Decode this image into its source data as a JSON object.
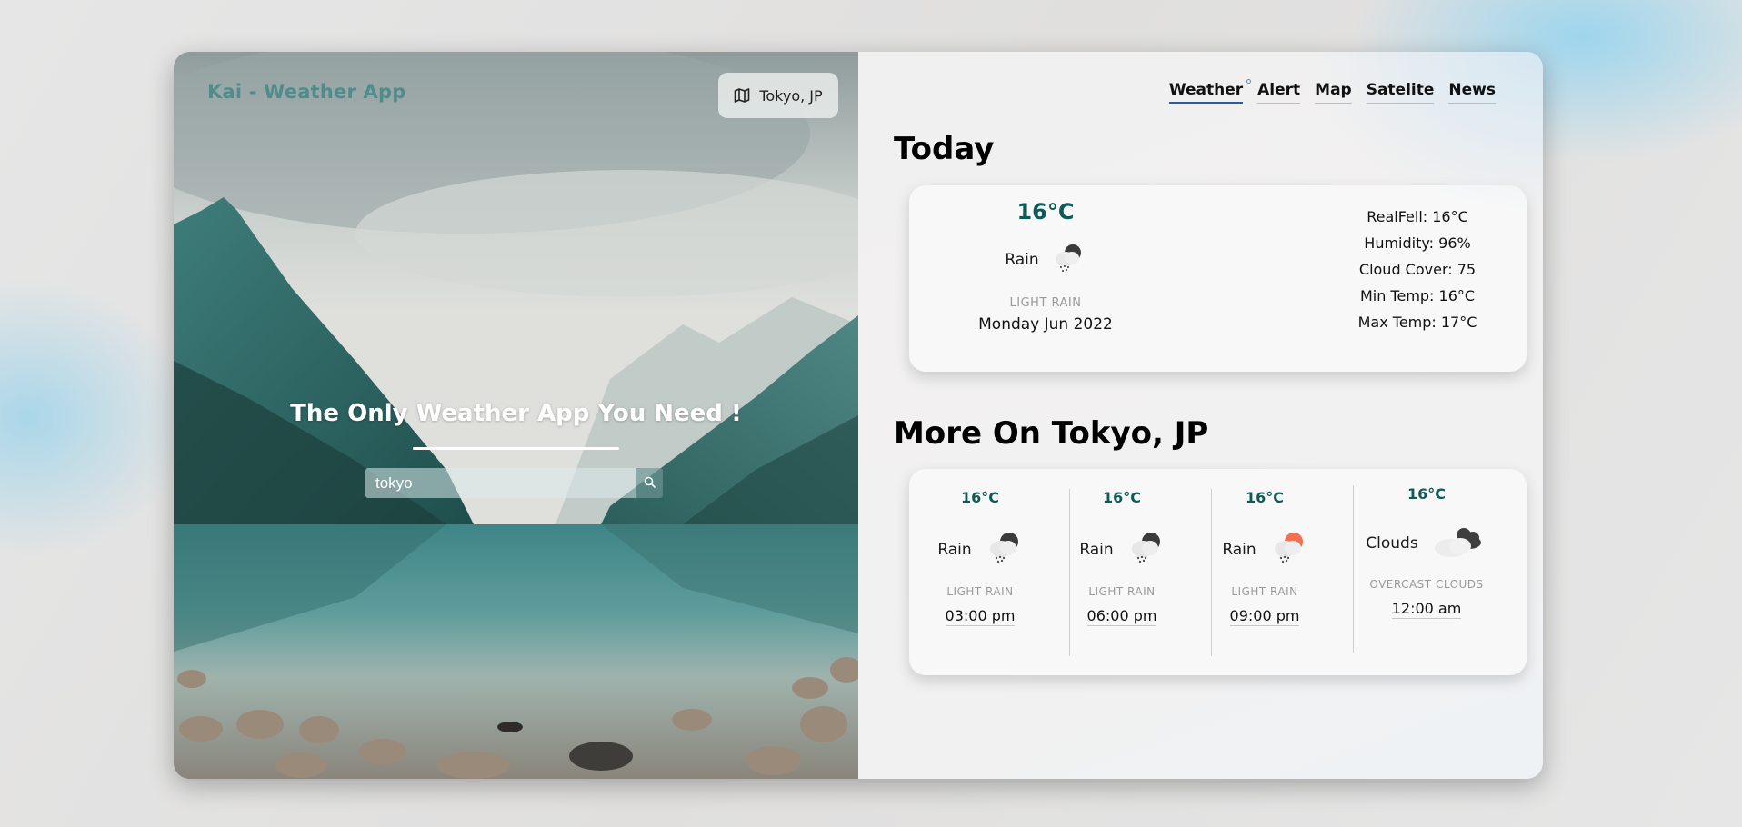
{
  "app": {
    "brand": "Kai - Weather App",
    "location_button": "Tokyo, JP"
  },
  "hero": {
    "title": "The Only Weather App You Need !",
    "search_value": "tokyo"
  },
  "nav": {
    "items": [
      {
        "label": "Weather",
        "active": true
      },
      {
        "label": "Alert",
        "active": false
      },
      {
        "label": "Map",
        "active": false
      },
      {
        "label": "Satelite",
        "active": false
      },
      {
        "label": "News",
        "active": false
      }
    ]
  },
  "today": {
    "heading": "Today",
    "temp": "16°C",
    "condition": "Rain",
    "condition_icon": "rain-cloud-icon",
    "description": "LIGHT RAIN",
    "date": "Monday Jun 2022",
    "details": [
      "RealFell: 16°C",
      "Humidity: 96%",
      "Cloud Cover: 75",
      "Min Temp: 16°C",
      "Max Temp: 17°C"
    ]
  },
  "more": {
    "heading": "More On Tokyo, JP",
    "forecast": [
      {
        "temp": "16°C",
        "condition": "Rain",
        "icon": "rain-cloud-icon",
        "description": "LIGHT RAIN",
        "time": "03:00 pm"
      },
      {
        "temp": "16°C",
        "condition": "Rain",
        "icon": "rain-cloud-icon",
        "description": "LIGHT RAIN",
        "time": "06:00 pm"
      },
      {
        "temp": "16°C",
        "condition": "Rain",
        "icon": "rain-sun-icon",
        "description": "LIGHT RAIN",
        "time": "09:00 pm"
      },
      {
        "temp": "16°C",
        "condition": "Clouds",
        "icon": "overcast-clouds-icon",
        "description": "OVERCAST CLOUDS",
        "time": "12:00 am"
      }
    ]
  },
  "colors": {
    "brand": "#4f8c8b",
    "temp": "#0d5a57",
    "nav_active_underline": "#2a5d9c"
  }
}
